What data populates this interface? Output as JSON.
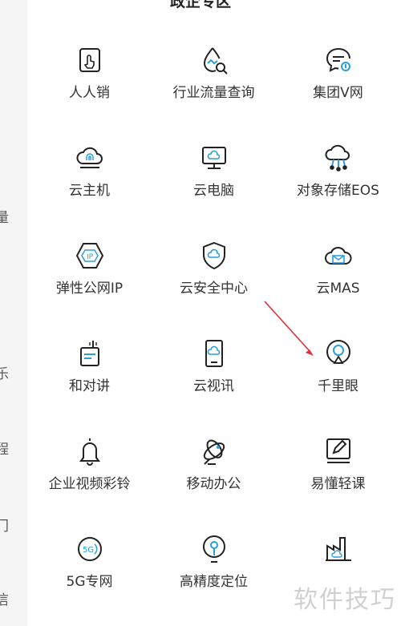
{
  "section": {
    "title": "政企专区"
  },
  "left_rail": {
    "chars": [
      "量",
      "乐",
      "程",
      "门",
      "信"
    ]
  },
  "tiles": [
    {
      "label": "人人销",
      "icon": "hand-tap-icon"
    },
    {
      "label": "行业流量查询",
      "icon": "drop-search-icon"
    },
    {
      "label": "集团V网",
      "icon": "chat-bubble-icon"
    },
    {
      "label": "云主机",
      "icon": "cloud-fingerprint-icon"
    },
    {
      "label": "云电脑",
      "icon": "cloud-monitor-icon"
    },
    {
      "label": "对象存储EOS",
      "icon": "cloud-nodes-icon"
    },
    {
      "label": "弹性公网IP",
      "icon": "ip-hexagon-icon"
    },
    {
      "label": "云安全中心",
      "icon": "cloud-shield-icon"
    },
    {
      "label": "云MAS",
      "icon": "cloud-mail-icon"
    },
    {
      "label": "和对讲",
      "icon": "walkie-talkie-icon"
    },
    {
      "label": "云视讯",
      "icon": "cloud-tablet-icon"
    },
    {
      "label": "千里眼",
      "icon": "camera-icon"
    },
    {
      "label": "企业视频彩铃",
      "icon": "bell-icon"
    },
    {
      "label": "移动办公",
      "icon": "satellite-dish-icon"
    },
    {
      "label": "易懂轻课",
      "icon": "edit-board-icon"
    },
    {
      "label": "5G专网",
      "icon": "5g-signal-icon"
    },
    {
      "label": "高精度定位",
      "icon": "location-pin-icon"
    },
    {
      "label": "",
      "icon": "cloud-factory-icon"
    }
  ],
  "watermark": {
    "text": "软件技巧"
  },
  "colors": {
    "accent": "#2a9fe0",
    "icon_stroke": "#222222",
    "arrow": "#e0343a"
  }
}
